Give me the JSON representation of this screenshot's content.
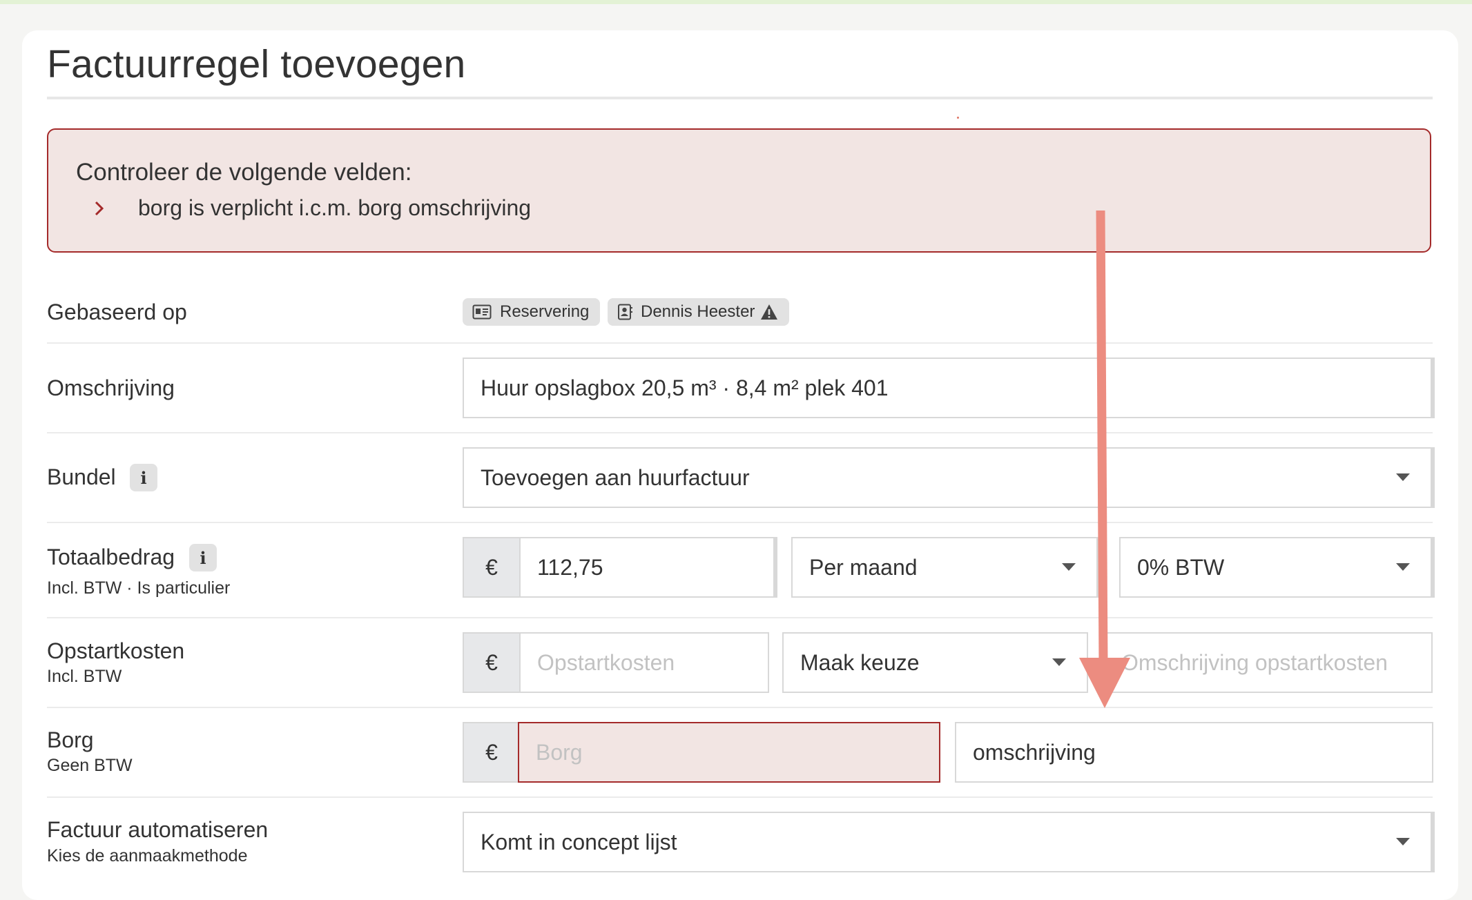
{
  "page": {
    "title": "Factuurregel toevoegen"
  },
  "alert": {
    "title": "Controleer de volgende velden:",
    "items": [
      "borg is verplicht i.c.m. borg omschrijving"
    ]
  },
  "form": {
    "gebaseerd_op": {
      "label": "Gebaseerd op",
      "tags": [
        {
          "label": "Reservering",
          "icon": "id-card-icon"
        },
        {
          "label": "Dennis Heester",
          "icon": "contact-book-icon",
          "warning_icon": "warning-triangle-icon"
        }
      ]
    },
    "omschrijving": {
      "label": "Omschrijving",
      "value": "Huur opslagbox 20,5 m³ · 8,4 m² plek 401"
    },
    "bundel": {
      "label": "Bundel",
      "info": "i",
      "value": "Toevoegen aan huurfactuur"
    },
    "totaalbedrag": {
      "label": "Totaalbedrag",
      "info": "i",
      "sublabel": "Incl. BTW · Is particulier",
      "currency": "€",
      "amount": "112,75",
      "period": "Per maand",
      "vat": "0% BTW"
    },
    "opstartkosten": {
      "label": "Opstartkosten",
      "sublabel": "Incl. BTW",
      "currency": "€",
      "amount_placeholder": "Opstartkosten",
      "choice": "Maak keuze",
      "description_placeholder": "Omschrijving opstartkosten"
    },
    "borg": {
      "label": "Borg",
      "sublabel": "Geen BTW",
      "currency": "€",
      "amount_placeholder": "Borg",
      "description": "omschrijving"
    },
    "factuur_automatiseren": {
      "label": "Factuur automatiseren",
      "sublabel": "Kies de aanmaakmethode",
      "value": "Komt in concept lijst"
    }
  },
  "colors": {
    "error_border": "#a42a2a",
    "error_bg": "#f2e5e3",
    "annotation_arrow": "#ec8c80"
  }
}
